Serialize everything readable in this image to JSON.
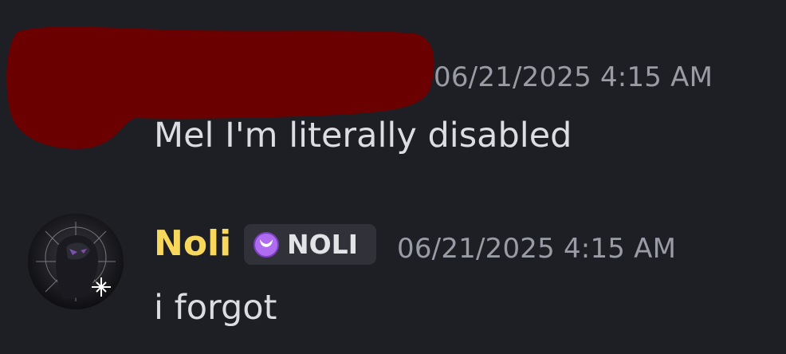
{
  "colors": {
    "background": "#1e1f25",
    "redaction": "#6a0000",
    "timestamp": "#9a9ca5",
    "message_text": "#dbdde3",
    "author_name": "#f7d75c",
    "tag_background": "#303139",
    "tag_icon": "#b06cf0"
  },
  "messages": [
    {
      "author_redacted": true,
      "timestamp": "06/21/2025 4:15 AM",
      "text": "Mel I'm literally disabled"
    },
    {
      "author": "Noli",
      "server_tag": {
        "icon": "purple-moon-icon",
        "label": "NOLI"
      },
      "avatar": "avatar-image",
      "timestamp": "06/21/2025 4:15 AM",
      "text": "i forgot"
    }
  ]
}
